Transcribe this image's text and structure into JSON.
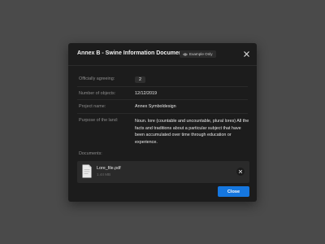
{
  "colors": {
    "accent": "#1577e0",
    "overlay": "#4a4a4a",
    "surface": "#1c1c1c",
    "card": "#2a2a2a"
  },
  "dialog": {
    "title": "Annex B - Swine Information Document",
    "badge": {
      "icon": "eye-icon",
      "label": "Example Only"
    },
    "close_icon": "close-icon"
  },
  "fields": [
    {
      "label": "Officially agreeing:",
      "value": "2"
    },
    {
      "label": "Number of objects:",
      "value": "12/12/2019"
    },
    {
      "label": "Project name:",
      "value": "Annex Symboldesign"
    },
    {
      "label": "Purpose of the land:",
      "value": "Noun. lore (countable and uncountable, plural lores) All the facts and traditions about a particular subject that have been accumulated over time through education or experience."
    }
  ],
  "documents": {
    "label": "Documents:",
    "files": [
      {
        "name": "Lore_file.pdf",
        "size": "1.44 MB",
        "icon": "file-icon"
      }
    ]
  },
  "footer": {
    "close_label": "Close"
  }
}
